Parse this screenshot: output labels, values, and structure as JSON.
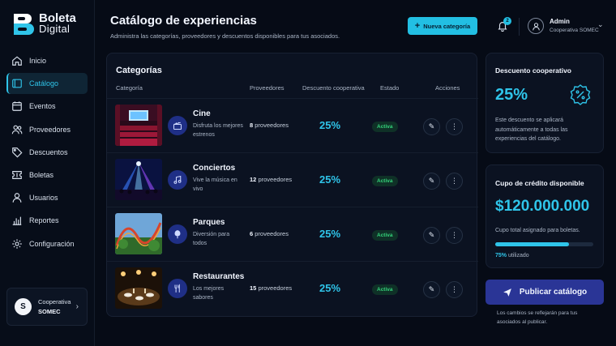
{
  "brand": {
    "name_line1": "Boleta",
    "name_line2": "Digital",
    "accent": "#2fc4e9"
  },
  "sidebar": {
    "items": [
      {
        "label": "Inicio",
        "icon": "home-icon",
        "active": false
      },
      {
        "label": "Catálogo",
        "icon": "catalog-icon",
        "active": true
      },
      {
        "label": "Eventos",
        "icon": "calendar-icon",
        "active": false
      },
      {
        "label": "Proveedores",
        "icon": "users-icon",
        "active": false
      },
      {
        "label": "Descuentos",
        "icon": "tag-icon",
        "active": false
      },
      {
        "label": "Boletas",
        "icon": "ticket-icon",
        "active": false
      },
      {
        "label": "Usuarios",
        "icon": "user-icon",
        "active": false
      },
      {
        "label": "Reportes",
        "icon": "chart-icon",
        "active": false
      },
      {
        "label": "Configuración",
        "icon": "gear-icon",
        "active": false
      }
    ],
    "coop": {
      "avatar": "S",
      "label": "Cooperativa",
      "name": "SOMEC"
    }
  },
  "header": {
    "title": "Catálogo de experiencias",
    "subtitle": "Administra las categorías, proveedores y descuentos disponibles para tus asociados.",
    "new_button": "Nueva categoría",
    "notifications": "2",
    "user": {
      "name": "Admin",
      "org": "Cooperativa SOMEC"
    }
  },
  "categories_panel": {
    "title": "Categorías",
    "columns": [
      "Categoría",
      "Proveedores",
      "Descuento cooperativa",
      "Estado",
      "Acciones"
    ],
    "rows": [
      {
        "name": "Cine",
        "description": "Disfruta los mejores estrenos",
        "providers_count": "8",
        "providers_label": "proveedores",
        "discount": "25%",
        "status": "Activa",
        "icon": "clapperboard-icon"
      },
      {
        "name": "Conciertos",
        "description": "Vive la música en vivo",
        "providers_count": "12",
        "providers_label": "proveedores",
        "discount": "25%",
        "status": "Activa",
        "icon": "music-note-icon"
      },
      {
        "name": "Parques",
        "description": "Diversión para todos",
        "providers_count": "6",
        "providers_label": "proveedores",
        "discount": "25%",
        "status": "Activa",
        "icon": "tree-icon"
      },
      {
        "name": "Restaurantes",
        "description": "Los mejores sabores",
        "providers_count": "15",
        "providers_label": "proveedores",
        "discount": "25%",
        "status": "Activa",
        "icon": "utensils-icon"
      }
    ]
  },
  "discount_card": {
    "title": "Descuento cooperativo",
    "value": "25%",
    "text": "Este descuento se aplicará automáticamente a todas las experiencias del catálogo."
  },
  "credit_card": {
    "title": "Cupo de crédito disponible",
    "amount": "$120.000.000",
    "text": "Cupo total asignado para boletas.",
    "used_fraction": 0.75,
    "used_pct": "75%",
    "used_label": "utilizado"
  },
  "publish": {
    "button": "Publicar catálogo",
    "note": "Los cambios se reflejarán para tus asociados al publicar."
  }
}
